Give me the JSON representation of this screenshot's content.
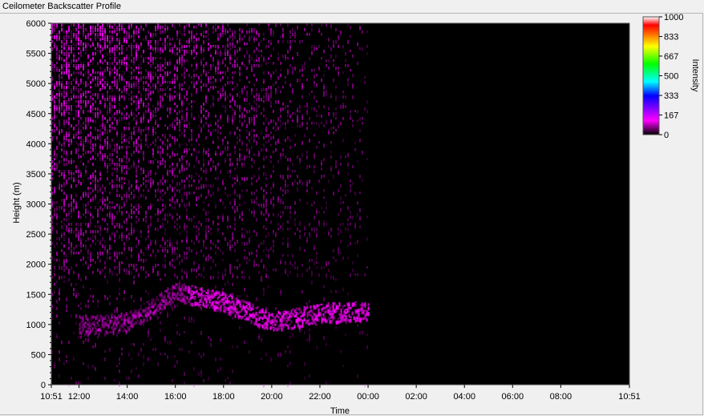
{
  "window": {
    "title": "Ceilometer Backscatter Profile"
  },
  "chart_data": {
    "type": "heatmap",
    "title": "Ceilometer Backscatter Profile",
    "xlabel": "Time",
    "ylabel": "Height (m)",
    "x_ticks": [
      "10:51",
      "12:00",
      "14:00",
      "16:00",
      "18:00",
      "20:00",
      "22:00",
      "00:00",
      "02:00",
      "04:00",
      "06:00",
      "08:00",
      "10:51"
    ],
    "xlim": [
      "10:51",
      "10:51 (+1 day)"
    ],
    "ylim": [
      0,
      6000
    ],
    "y_ticks": [
      0,
      500,
      1000,
      1500,
      2000,
      2500,
      3000,
      3500,
      4000,
      4500,
      5000,
      5500,
      6000
    ],
    "data_end_time": "00:00",
    "colorbar": {
      "label": "Intensity",
      "range": [
        0,
        1000
      ],
      "ticks": [
        0,
        167,
        333,
        500,
        667,
        833,
        1000
      ],
      "colors": [
        "#000000",
        "#ff00ff",
        "#0000ff",
        "#00ffff",
        "#00ff00",
        "#ffff00",
        "#ff0000",
        "#ffffff"
      ]
    },
    "features": [
      {
        "name": "aerosol layer",
        "x": [
          "12:00",
          "14:00",
          "16:00",
          "18:00",
          "20:00",
          "22:00",
          "00:00"
        ],
        "y": [
          1000,
          1050,
          1550,
          1400,
          1050,
          1200,
          1250
        ]
      }
    ],
    "grid": false,
    "legend": "none"
  }
}
